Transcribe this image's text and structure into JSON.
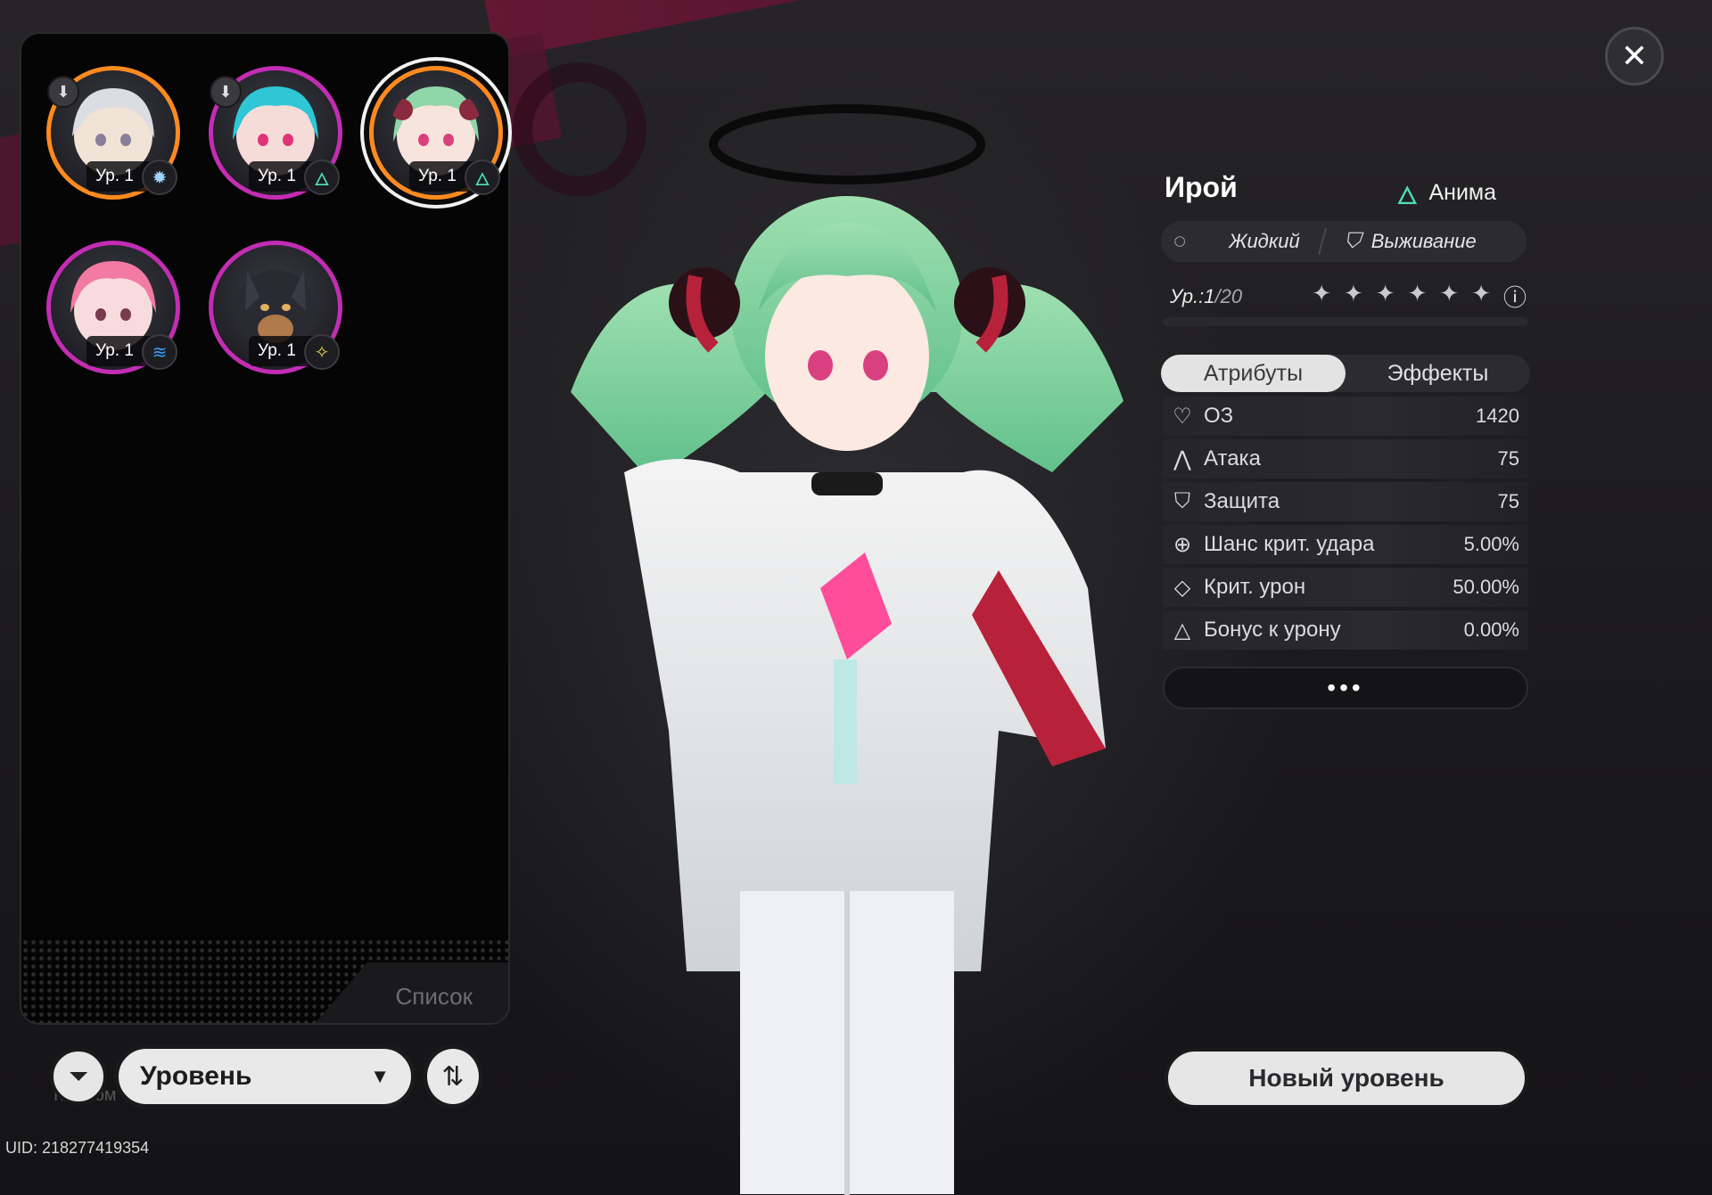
{
  "roster": {
    "list_label": "Список",
    "characters": [
      {
        "level": "Ур. 1",
        "element_icon": "gear-sun-icon",
        "frame": "orange",
        "pinned": true
      },
      {
        "level": "Ур. 1",
        "element_icon": "anima-flame-icon",
        "frame": "magenta",
        "pinned": true
      },
      {
        "level": "Ур. 1",
        "element_icon": "anima-flame-icon",
        "frame": "orange",
        "selected": true
      },
      {
        "level": "Ур. 1",
        "element_icon": "wave-icon",
        "frame": "magenta"
      },
      {
        "level": "Ур. 1",
        "element_icon": "star-burst-icon",
        "frame": "magenta"
      }
    ]
  },
  "controls": {
    "sort_label": "Уровень",
    "costume_hint": "Костюм",
    "uid": "UID: 218277419354"
  },
  "character": {
    "name": "Ирой",
    "element": "Анима",
    "tags": [
      "Жидкий",
      "Выживание"
    ],
    "level_prefix": "Ур.:",
    "level": "1",
    "level_max": "/20",
    "stars": 6
  },
  "tabs": [
    "Атрибуты",
    "Эффекты"
  ],
  "stats": [
    {
      "icon": "heart-icon",
      "glyph": "♡",
      "label": "ОЗ",
      "value": "1420"
    },
    {
      "icon": "attack-icon",
      "glyph": "⋀",
      "label": "Атака",
      "value": "75"
    },
    {
      "icon": "shield-icon",
      "glyph": "⛉",
      "label": "Защита",
      "value": "75"
    },
    {
      "icon": "crit-rate-icon",
      "glyph": "⊕",
      "label": "Шанс крит. удара",
      "value": "5.00%"
    },
    {
      "icon": "crit-dmg-icon",
      "glyph": "◇",
      "label": "Крит. урон",
      "value": "50.00%"
    },
    {
      "icon": "dmg-bonus-icon",
      "glyph": "△",
      "label": "Бонус к урону",
      "value": "0.00%"
    }
  ],
  "buttons": {
    "more": "•••",
    "level_up": "Новый уровень",
    "close": "✕"
  },
  "colors": {
    "accent_magenta": "#c22db3",
    "accent_orange": "#ff8a1f",
    "anima_green": "#4fe0b0"
  }
}
